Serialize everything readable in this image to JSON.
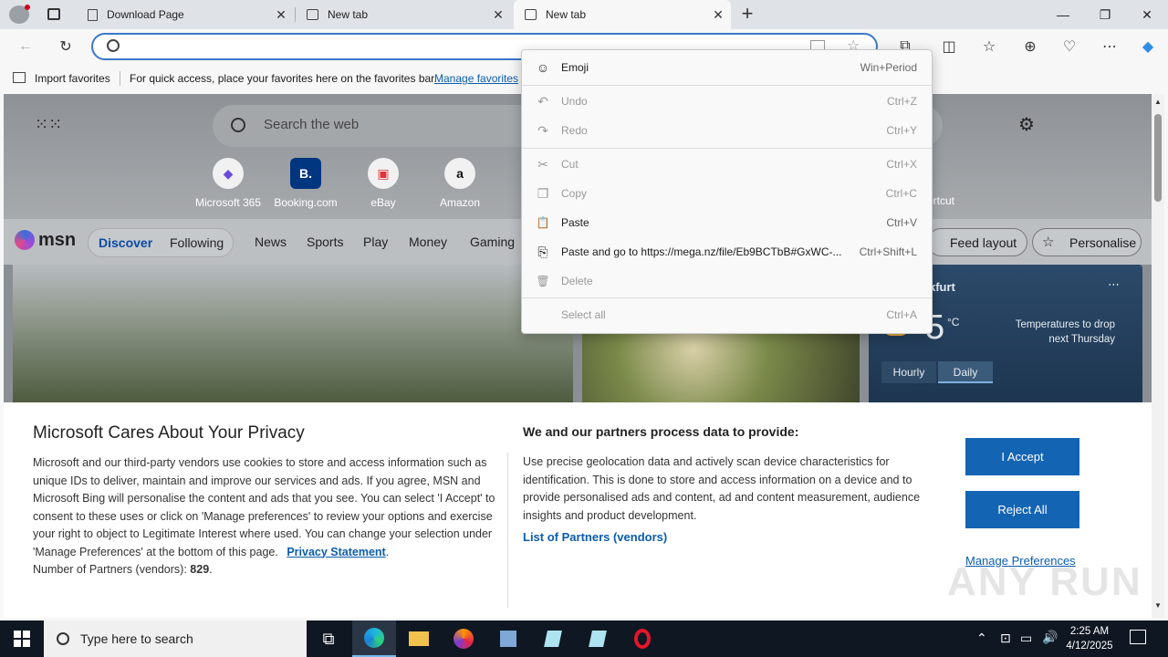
{
  "browser": {
    "tabs": [
      {
        "title": "Download Page",
        "icon": "page-icon",
        "active": false
      },
      {
        "title": "New tab",
        "icon": "newtab-icon",
        "active": false
      },
      {
        "title": "New tab",
        "icon": "newtab-icon",
        "active": true
      }
    ],
    "new_tab_symbol": "+",
    "close_symbol": "✕"
  },
  "favorites_bar": {
    "import_label": "Import favorites",
    "hint_text": "For quick access, place your favorites here on the favorites bar.",
    "manage_link": "Manage favorites"
  },
  "msn_page": {
    "search_placeholder": "Search the web",
    "quick_links": [
      {
        "label": "Microsoft 365",
        "glyph": "◆"
      },
      {
        "label": "Booking.com",
        "glyph": "B."
      },
      {
        "label": "eBay",
        "glyph": "▣"
      },
      {
        "label": "Amazon",
        "glyph": "a"
      }
    ],
    "shortcut_label": "ortcut",
    "logo": "msn",
    "nav": {
      "discover": "Discover",
      "following": "Following",
      "links": [
        "News",
        "Sports",
        "Play",
        "Money",
        "Gaming"
      ]
    },
    "feed_layout": "Feed layout",
    "personalise": "Personalise",
    "weather": {
      "location": "kfurt",
      "temp": "5",
      "unit": "°C",
      "note": "Temperatures to drop next Thursday",
      "tab_hourly": "Hourly",
      "tab_daily": "Daily"
    }
  },
  "context_menu": {
    "items": [
      {
        "label": "Emoji",
        "shortcut": "Win+Period",
        "icon": "emoji-icon",
        "glyph": "☺",
        "enabled": true
      },
      {
        "label": "Undo",
        "shortcut": "Ctrl+Z",
        "icon": "undo-icon",
        "glyph": "↶",
        "enabled": false
      },
      {
        "label": "Redo",
        "shortcut": "Ctrl+Y",
        "icon": "redo-icon",
        "glyph": "↷",
        "enabled": false
      },
      {
        "label": "Cut",
        "shortcut": "Ctrl+X",
        "icon": "cut-icon",
        "glyph": "✂",
        "enabled": false
      },
      {
        "label": "Copy",
        "shortcut": "Ctrl+C",
        "icon": "copy-icon",
        "glyph": "❐",
        "enabled": false
      },
      {
        "label": "Paste",
        "shortcut": "Ctrl+V",
        "icon": "paste-icon",
        "glyph": "📋",
        "enabled": true
      },
      {
        "label": "Paste and go to https://mega.nz/file/Eb9BCTbB#GxWC-...",
        "shortcut": "Ctrl+Shift+L",
        "icon": "paste-go-icon",
        "glyph": "⎘",
        "enabled": true
      },
      {
        "label": "Delete",
        "shortcut": "",
        "icon": "delete-icon",
        "glyph": "🗑",
        "enabled": false
      },
      {
        "label": "Select all",
        "shortcut": "Ctrl+A",
        "icon": "",
        "glyph": "",
        "enabled": false
      }
    ]
  },
  "privacy": {
    "title": "Microsoft Cares About Your Privacy",
    "body": "Microsoft and our third-party vendors use cookies to store and access information such as unique IDs to deliver, maintain and improve our services and ads. If you agree, MSN and Microsoft Bing will personalise the content and ads that you see. You can select 'I Accept' to consent to these uses or click on 'Manage preferences' to review your options and exercise your right to object to Legitimate Interest where used.  You can change your selection under 'Manage Preferences' at the bottom of this page.",
    "privacy_link": "Privacy Statement",
    "partners_count_label": "Number of Partners (vendors):",
    "partners_count": "829",
    "partners_title": "We and our partners process data to provide:",
    "partners_body": "Use precise geolocation data and actively scan device characteristics for identification. This is done to store and access information on a device and to provide personalised ads and content, ad and content measurement, audience insights and product development.",
    "partners_link": "List of Partners (vendors)",
    "accept": "I Accept",
    "reject": "Reject All",
    "manage": "Manage Preferences"
  },
  "watermark": "ANY RUN",
  "taskbar": {
    "search_placeholder": "Type here to search",
    "time": "2:25 AM",
    "date": "4/12/2025"
  }
}
